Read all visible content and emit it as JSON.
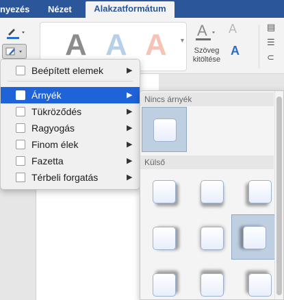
{
  "tabs": {
    "tab_left_partial": "nyezés",
    "tab_view": "Nézet",
    "tab_shape_format": "Alakzatformátum"
  },
  "ribbon": {
    "wordart_letter": "A",
    "text_fill_letter": "A",
    "text_fill_label": "Szöveg kitöltése",
    "text_outline_letter": "A",
    "text_effects_letter": "A",
    "gallery_colors": [
      "#8c8c8c",
      "#b7d0e8",
      "#f5c4b6"
    ]
  },
  "menu": {
    "items": [
      {
        "label": "Beépített elemek"
      },
      {
        "label": "Árnyék"
      },
      {
        "label": "Tükröződés"
      },
      {
        "label": "Ragyogás"
      },
      {
        "label": "Finom élek"
      },
      {
        "label": "Fazetta"
      },
      {
        "label": "Térbeli forgatás"
      }
    ],
    "selected_color": "#1f63d8"
  },
  "submenu": {
    "section_no_shadow": "Nincs árnyék",
    "section_outer": "Külső"
  },
  "colors": {
    "tab_bar": "#2b579a",
    "ribbon_bg": "#f3f3f3",
    "accent_blue": "#2b6cc4"
  }
}
